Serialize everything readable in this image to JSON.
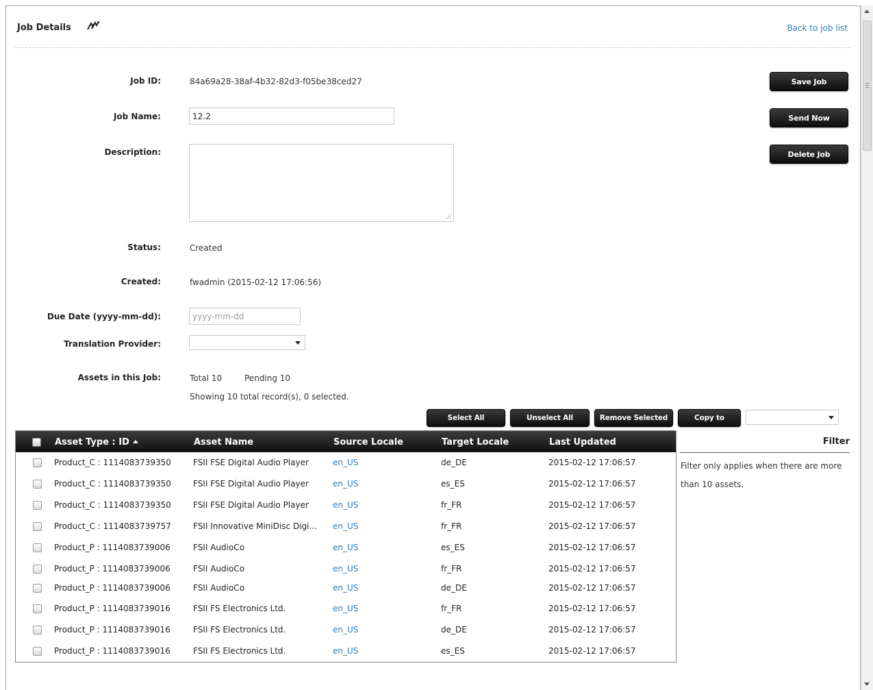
{
  "header": {
    "title": "Job Details",
    "back_link": "Back to job list"
  },
  "form": {
    "job_id_label": "Job ID:",
    "job_id": "84a69a28-38af-4b32-82d3-f05be38ced27",
    "job_name_label": "Job Name:",
    "job_name": "12.2",
    "description_label": "Description:",
    "description": "",
    "status_label": "Status:",
    "status": "Created",
    "created_label": "Created:",
    "created": "fwadmin (2015-02-12 17:06:56)",
    "due_date_label": "Due Date (yyyy-mm-dd):",
    "due_date_placeholder": "yyyy-mm-dd",
    "provider_label": "Translation Provider:",
    "provider_value": "",
    "assets_label": "Assets in this Job:",
    "assets_total": "Total 10",
    "assets_pending": "Pending 10",
    "showing": "Showing 10 total record(s), 0 selected."
  },
  "actions": {
    "save": "Save Job",
    "send": "Send Now",
    "delete": "Delete Job"
  },
  "toolbar": {
    "select_all": "Select All",
    "unselect_all": "Unselect All",
    "remove_selected": "Remove Selected",
    "copy_to": "Copy to",
    "copy_to_value": ""
  },
  "table": {
    "columns": [
      "Asset Type : ID",
      "Asset Name",
      "Source Locale",
      "Target Locale",
      "Last Updated"
    ],
    "rows": [
      [
        "Product_C : 1114083739350",
        "FSII FSE Digital Audio Player",
        "en_US",
        "de_DE",
        "2015-02-12 17:06:57"
      ],
      [
        "Product_C : 1114083739350",
        "FSII FSE Digital Audio Player",
        "en_US",
        "es_ES",
        "2015-02-12 17:06:57"
      ],
      [
        "Product_C : 1114083739350",
        "FSII FSE Digital Audio Player",
        "en_US",
        "fr_FR",
        "2015-02-12 17:06:57"
      ],
      [
        "Product_C : 1114083739757",
        "FSII Innovative MiniDisc Digi...",
        "en_US",
        "fr_FR",
        "2015-02-12 17:06:57"
      ],
      [
        "Product_P : 1114083739006",
        "FSII AudioCo",
        "en_US",
        "es_ES",
        "2015-02-12 17:06:57"
      ],
      [
        "Product_P : 1114083739006",
        "FSII AudioCo",
        "en_US",
        "fr_FR",
        "2015-02-12 17:06:57"
      ],
      [
        "Product_P : 1114083739006",
        "FSII AudioCo",
        "en_US",
        "de_DE",
        "2015-02-12 17:06:57"
      ],
      [
        "Product_P : 1114083739016",
        "FSII FS Electronics Ltd.",
        "en_US",
        "fr_FR",
        "2015-02-12 17:06:57"
      ],
      [
        "Product_P : 1114083739016",
        "FSII FS Electronics Ltd.",
        "en_US",
        "de_DE",
        "2015-02-12 17:06:57"
      ],
      [
        "Product_P : 1114083739016",
        "FSII FS Electronics Ltd.",
        "en_US",
        "es_ES",
        "2015-02-12 17:06:57"
      ]
    ]
  },
  "filter": {
    "title": "Filter",
    "note": "Filter only applies when there are more than 10 assets."
  },
  "colors": {
    "link": "#2f79b8",
    "button_dark": "#111111"
  }
}
